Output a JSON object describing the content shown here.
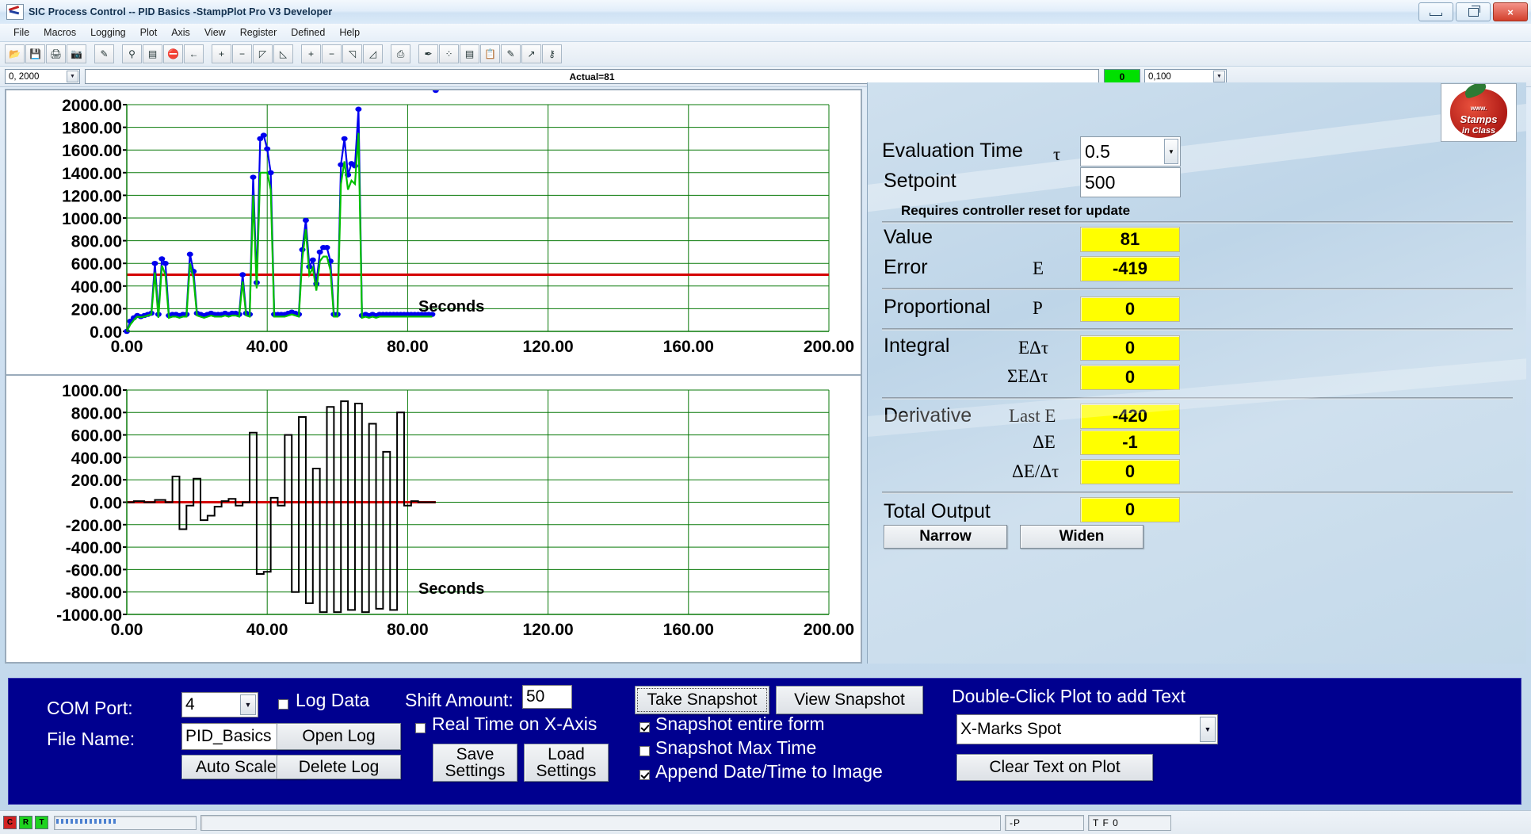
{
  "window": {
    "title": "SIC Process Control -- PID Basics -StampPlot Pro V3 Developer",
    "app_icon": "stampplot-icon",
    "buttons": {
      "minimize": "minimize-icon",
      "restore": "restore-icon",
      "close": "×"
    }
  },
  "menu": {
    "items": [
      "File",
      "Macros",
      "Logging",
      "Plot",
      "Axis",
      "View",
      "Register",
      "Defined",
      "Help"
    ]
  },
  "toolbar": {
    "icons": [
      {
        "name": "open-folder-icon",
        "glyph": "📂"
      },
      {
        "name": "save-disk-icon",
        "glyph": "💾"
      },
      {
        "name": "print-icon",
        "glyph": "🖨"
      },
      {
        "name": "camera-snapshot-icon",
        "glyph": "📷"
      },
      {
        "sep": true
      },
      {
        "name": "wand-icon",
        "glyph": "✎"
      },
      {
        "sep": true
      },
      {
        "name": "connect-plot-icon",
        "glyph": "⚲"
      },
      {
        "name": "terminal-icon",
        "glyph": "▤"
      },
      {
        "name": "stop-icon",
        "glyph": "⛔"
      },
      {
        "name": "back-arrow-icon",
        "glyph": "←"
      },
      {
        "sep": true
      },
      {
        "name": "zoom-in-x-icon",
        "glyph": "+"
      },
      {
        "name": "zoom-out-x-icon",
        "glyph": "−"
      },
      {
        "name": "shift-left-icon",
        "glyph": "◸"
      },
      {
        "name": "shift-right-icon",
        "glyph": "◺"
      },
      {
        "sep": true
      },
      {
        "name": "zoom-in-y-icon",
        "glyph": "+"
      },
      {
        "name": "zoom-out-y-icon",
        "glyph": "−"
      },
      {
        "name": "scale-up-icon",
        "glyph": "◹"
      },
      {
        "name": "scale-down-icon",
        "glyph": "◿"
      },
      {
        "sep": true
      },
      {
        "name": "export-pdf-icon",
        "glyph": "⎙"
      },
      {
        "sep": true
      },
      {
        "name": "pen-icon",
        "glyph": "✒"
      },
      {
        "name": "data-points-icon",
        "glyph": "⁘"
      },
      {
        "name": "notes-icon",
        "glyph": "▤"
      },
      {
        "name": "clipboard-icon",
        "glyph": "📋"
      },
      {
        "name": "marker-icon",
        "glyph": "✎"
      },
      {
        "name": "trend-icon",
        "glyph": "↗"
      },
      {
        "name": "key-icon",
        "glyph": "⚷"
      }
    ]
  },
  "param_strip": {
    "yrange_value": "0, 2000",
    "actual_text": "Actual=81",
    "green_value": "0",
    "xrange_value": "0,100"
  },
  "chart_data": [
    {
      "type": "line",
      "name": "process-value-plot",
      "title": "",
      "xlabel": "Seconds",
      "ylabel": "",
      "xlim": [
        0,
        200
      ],
      "ylim": [
        0,
        2000
      ],
      "xticks": [
        "0.00",
        "40.00",
        "80.00",
        "120.00",
        "160.00",
        "200.00"
      ],
      "yticks": [
        "0.00",
        "200.00",
        "400.00",
        "600.00",
        "800.00",
        "1000.00",
        "1200.00",
        "1400.00",
        "1600.00",
        "1800.00",
        "2000.00"
      ],
      "grid": true,
      "series": [
        {
          "name": "setpoint",
          "color": "#d40000",
          "type": "hline",
          "value": 500
        },
        {
          "name": "value-blue",
          "color": "#0000ee",
          "marker": "dot",
          "x": [
            0,
            1,
            2,
            3,
            4,
            5,
            6,
            7,
            8,
            9,
            10,
            11,
            12,
            13,
            14,
            15,
            16,
            17,
            18,
            19,
            20,
            21,
            22,
            23,
            24,
            25,
            26,
            27,
            28,
            29,
            30,
            31,
            32,
            33,
            34,
            35,
            36,
            37,
            38,
            39,
            40,
            41,
            42,
            43,
            44,
            45,
            46,
            47,
            48,
            49,
            50,
            51,
            52,
            53,
            54,
            55,
            56,
            57,
            58,
            59,
            60,
            61,
            62,
            63,
            64,
            65,
            66,
            67,
            68,
            69,
            70,
            71,
            72,
            73,
            74,
            75,
            76,
            77,
            78,
            79,
            80,
            81,
            82,
            83,
            84,
            85,
            86,
            87,
            88
          ],
          "y": [
            0,
            90,
            120,
            140,
            130,
            140,
            150,
            160,
            600,
            150,
            640,
            600,
            140,
            150,
            150,
            140,
            150,
            150,
            680,
            530,
            160,
            150,
            140,
            150,
            160,
            150,
            150,
            150,
            160,
            150,
            160,
            160,
            150,
            500,
            160,
            150,
            1360,
            430,
            1700,
            1730,
            1610,
            1400,
            150,
            150,
            150,
            150,
            160,
            170,
            160,
            150,
            720,
            980,
            570,
            630,
            420,
            700,
            740,
            740,
            620,
            150,
            150,
            1470,
            1700,
            1380,
            1480,
            1460,
            1960,
            140,
            150,
            140,
            150,
            140,
            150,
            150,
            150,
            150,
            150,
            150,
            150,
            150,
            150,
            150,
            150,
            150,
            150,
            150,
            150,
            150
          ]
        },
        {
          "name": "output-green",
          "color": "#00c000",
          "x": [
            0,
            1,
            2,
            3,
            4,
            5,
            6,
            7,
            8,
            9,
            10,
            11,
            12,
            13,
            14,
            15,
            16,
            17,
            18,
            19,
            20,
            21,
            22,
            23,
            24,
            25,
            26,
            27,
            28,
            29,
            30,
            31,
            32,
            33,
            34,
            35,
            36,
            37,
            38,
            39,
            40,
            41,
            42,
            43,
            44,
            45,
            46,
            47,
            48,
            49,
            50,
            51,
            52,
            53,
            54,
            55,
            56,
            57,
            58,
            59,
            60,
            61,
            62,
            63,
            64,
            65,
            66,
            67,
            68,
            69,
            70,
            71,
            72,
            73,
            74,
            75,
            76,
            77,
            78,
            79,
            80,
            81,
            82,
            83,
            84,
            85,
            86,
            87,
            88
          ],
          "y": [
            0,
            60,
            100,
            130,
            125,
            130,
            140,
            150,
            520,
            120,
            580,
            500,
            120,
            130,
            130,
            120,
            130,
            130,
            600,
            470,
            140,
            130,
            120,
            130,
            140,
            130,
            130,
            130,
            140,
            130,
            140,
            140,
            130,
            440,
            140,
            130,
            1200,
            380,
            1400,
            1400,
            1400,
            1250,
            130,
            130,
            130,
            130,
            140,
            150,
            140,
            130,
            640,
            900,
            500,
            560,
            360,
            620,
            660,
            660,
            540,
            130,
            130,
            1300,
            1500,
            1250,
            1330,
            1300,
            1750,
            120,
            130,
            120,
            130,
            120,
            130,
            130,
            130,
            130,
            130,
            130,
            130,
            130,
            130,
            130,
            130,
            130,
            130,
            130,
            130,
            130
          ]
        }
      ]
    },
    {
      "type": "line",
      "name": "error-plot",
      "title": "",
      "xlabel": "Seconds",
      "ylabel": "",
      "xlim": [
        0,
        200
      ],
      "ylim": [
        -1000,
        1000
      ],
      "xticks": [
        "0.00",
        "40.00",
        "80.00",
        "120.00",
        "160.00",
        "200.00"
      ],
      "yticks": [
        "-1000.00",
        "-800.00",
        "-600.00",
        "-400.00",
        "-200.00",
        "0.00",
        "200.00",
        "400.00",
        "600.00",
        "800.00",
        "1000.00"
      ],
      "grid": true,
      "series": [
        {
          "name": "zero-line",
          "color": "#d40000",
          "type": "hline",
          "value": 0
        },
        {
          "name": "error-black",
          "color": "#000000",
          "x": [
            0,
            2,
            5,
            8,
            11,
            13,
            15,
            17,
            19,
            21,
            23,
            25,
            27,
            29,
            31,
            33,
            35,
            37,
            39,
            41,
            43,
            45,
            47,
            49,
            51,
            53,
            55,
            57,
            59,
            61,
            63,
            65,
            67,
            69,
            71,
            73,
            75,
            77,
            79,
            81,
            83,
            85,
            88
          ],
          "y": [
            0,
            10,
            0,
            20,
            0,
            230,
            -240,
            -30,
            210,
            -160,
            -120,
            -40,
            10,
            30,
            -30,
            0,
            620,
            -640,
            -620,
            40,
            -30,
            600,
            -800,
            760,
            -900,
            300,
            -980,
            850,
            -980,
            900,
            -960,
            880,
            -980,
            700,
            -950,
            450,
            -960,
            800,
            -30,
            10,
            0,
            0,
            0
          ]
        }
      ]
    }
  ],
  "pid_panel": {
    "logo": {
      "name": "stamps-in-class-logo",
      "line1": "Stamps",
      "line2": "in Class",
      "top": "www."
    },
    "evaluation_time": {
      "label": "Evaluation Time",
      "symbol": "τ",
      "value": "0.5"
    },
    "setpoint": {
      "label": "Setpoint",
      "value": "500"
    },
    "reset_note": "Requires controller reset for update",
    "value": {
      "label": "Value",
      "symbol": "",
      "value": "81"
    },
    "error": {
      "label": "Error",
      "symbol": "E",
      "value": "-419"
    },
    "proportional": {
      "label": "Proportional",
      "symbol": "P",
      "value": "0"
    },
    "integral": {
      "label": "Integral",
      "symbol": "EΔτ",
      "value": "0"
    },
    "integral_sum": {
      "symbol": "ΣEΔτ",
      "value": "0"
    },
    "derivative": {
      "label": "Derivative",
      "symbol": "Last E",
      "value": "-420"
    },
    "derivative_de": {
      "symbol": "ΔE",
      "value": "-1"
    },
    "derivative_rate": {
      "symbol": "ΔE/Δτ",
      "value": "0"
    },
    "total_output": {
      "label": "Total Output",
      "value": "0"
    },
    "narrow_button": "Narrow",
    "widen_button": "Widen",
    "accent_yellow": "#ffff00",
    "panel_blue": "#c3d9ea"
  },
  "bottom_panel": {
    "background": "#00008f",
    "com_port_label": "COM Port:",
    "com_port_value": "4",
    "file_name_label": "File Name:",
    "file_name_value": "PID_Basics",
    "auto_scale_y_button": "Auto Scale Y",
    "log_data_label": "Log Data",
    "log_data_checked": false,
    "open_log_button": "Open Log",
    "delete_log_button": "Delete Log",
    "shift_amount_label": "Shift Amount:",
    "shift_amount_value": "50",
    "real_time_label": "Real Time on X-Axis",
    "real_time_checked": false,
    "save_settings_button": "Save Settings",
    "load_settings_button": "Load Settings",
    "take_snapshot_button": "Take Snapshot",
    "view_snapshot_button": "View Snapshot",
    "snapshot_entire_form_label": "Snapshot entire form",
    "snapshot_entire_form_checked": true,
    "snapshot_max_time_label": "Snapshot Max Time",
    "snapshot_max_time_checked": false,
    "append_datetime_label": "Append Date/Time to Image",
    "append_datetime_checked": true,
    "double_click_label": "Double-Click Plot to add Text",
    "text_mode_value": "X-Marks Spot",
    "clear_text_button": "Clear Text on Plot"
  },
  "status_bar": {
    "led_c": "C",
    "led_r": "R",
    "led_t": "T",
    "field_p": "-P",
    "field_tf": "T F 0",
    "message": ""
  }
}
